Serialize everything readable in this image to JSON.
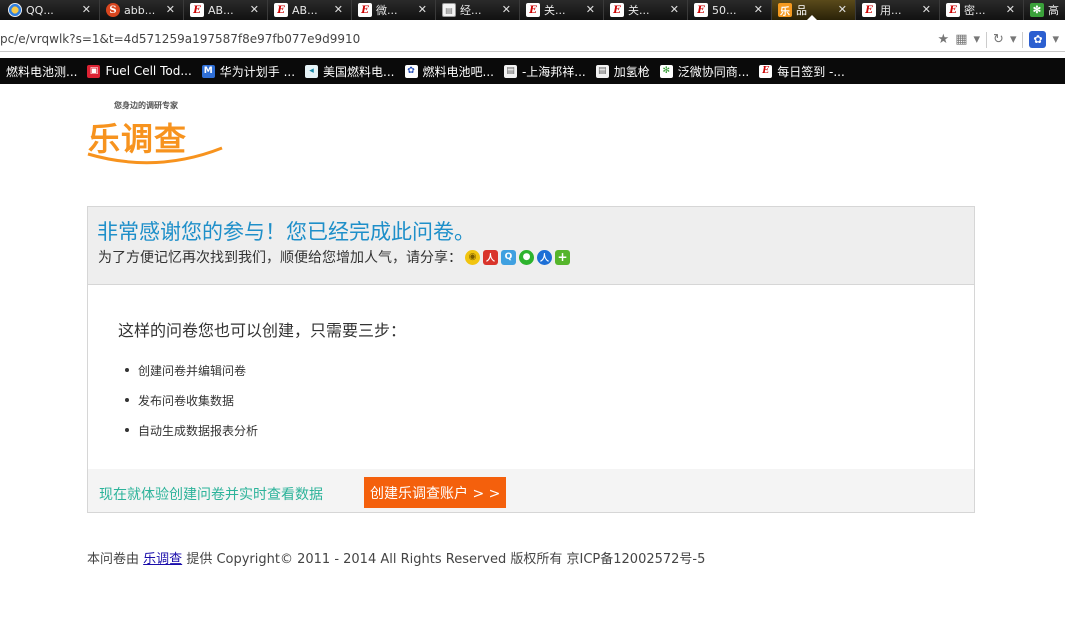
{
  "browser": {
    "tabs": [
      {
        "title": "QQ...",
        "icon": "qq-icon",
        "glyph": ""
      },
      {
        "title": "abb...",
        "icon": "sogou-icon",
        "glyph": "S"
      },
      {
        "title": "AB...",
        "icon": "e-site-icon",
        "glyph": "E"
      },
      {
        "title": "AB...",
        "icon": "e-site-icon",
        "glyph": "E"
      },
      {
        "title": "微...",
        "icon": "e-site-icon",
        "glyph": "E"
      },
      {
        "title": "经...",
        "icon": "page-icon",
        "glyph": "▤"
      },
      {
        "title": "关...",
        "icon": "e-site-icon",
        "glyph": "E"
      },
      {
        "title": "关...",
        "icon": "e-site-icon",
        "glyph": "E"
      },
      {
        "title": "50...",
        "icon": "e-site-icon",
        "glyph": "E"
      },
      {
        "title": "品",
        "icon": "le-survey-icon",
        "glyph": "乐",
        "active": true
      },
      {
        "title": "用...",
        "icon": "e-site-icon",
        "glyph": "E"
      },
      {
        "title": "密...",
        "icon": "e-site-icon",
        "glyph": "E"
      },
      {
        "title": "高",
        "icon": "green-gear-icon",
        "glyph": "✻"
      }
    ],
    "tab_close": "✕",
    "address": "pc/e/vrqwlk?s=1&t=4d571259a197587f8e97fb077e9d9910",
    "bookmarks": [
      {
        "label": "燃料电池测...",
        "icon": "none"
      },
      {
        "label": "Fuel Cell Tod...",
        "icon": "image-icon",
        "glyph": "▣"
      },
      {
        "label": "华为计划手 ...",
        "icon": "blue-site-icon",
        "glyph": "M"
      },
      {
        "label": "美国燃料电...",
        "icon": "cyan-site-icon",
        "glyph": "◂"
      },
      {
        "label": "燃料电池吧...",
        "icon": "paw-icon",
        "glyph": "✿"
      },
      {
        "label": "-上海邦祥...",
        "icon": "page-icon",
        "glyph": "▤"
      },
      {
        "label": "加氢枪",
        "icon": "page-icon",
        "glyph": "▤"
      },
      {
        "label": "泛微协同商...",
        "icon": "green-gear-icon",
        "glyph": "✻"
      },
      {
        "label": "每日签到 -...",
        "icon": "e-site-icon",
        "glyph": "E"
      }
    ]
  },
  "logo": {
    "tagline": "您身边的调研专家",
    "name": "乐调查"
  },
  "panel": {
    "thanks": "非常感谢您的参与！您已经完成此问卷。",
    "share_text": "为了方便记忆再次找到我们，顺便给您增加人气，请分享：",
    "share_icons": [
      "weibo-icon",
      "renren-icon",
      "qq-space-icon",
      "wechat-icon",
      "baidu-icon",
      "more-share-icon"
    ],
    "steps_title": "这样的问卷您也可以创建，只需要三步：",
    "steps": [
      "创建问卷并编辑问卷",
      "发布问卷收集数据",
      "自动生成数据报表分析"
    ],
    "cta_text": "现在就体验创建问卷并实时查看数据",
    "cta_button": "创建乐调查账户 > >"
  },
  "footer": {
    "prefix": "本问卷由",
    "link": "乐调查",
    "suffix": "提供   Copyright© 2011 - 2014 All Rights Reserved 版权所有   京ICP备12002572号-5"
  },
  "colors": {
    "brand_orange": "#f7931e",
    "thanks_blue": "#1e8fc9",
    "cta_teal": "#2cb39a",
    "button_orange": "#f4600c"
  }
}
